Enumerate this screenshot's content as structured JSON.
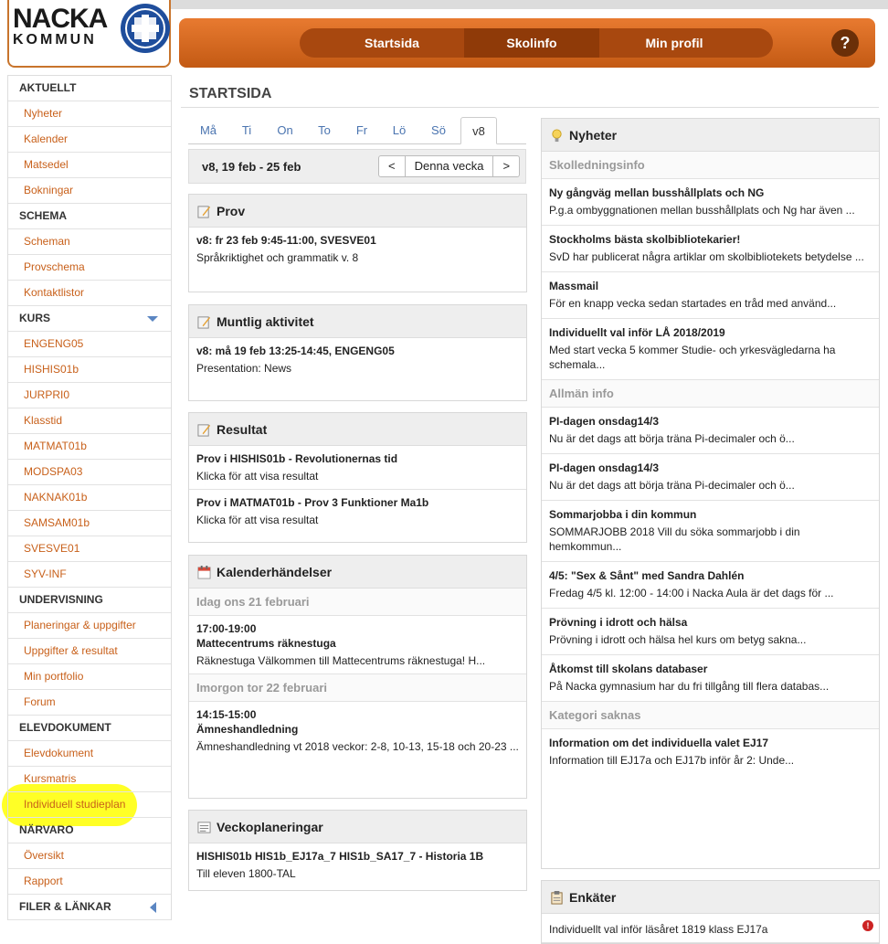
{
  "logo": {
    "line1": "NACKA",
    "line2": "KOMMUN"
  },
  "nav": {
    "startsida": "Startsida",
    "skolinfo": "Skolinfo",
    "minprofil": "Min profil",
    "help": "?"
  },
  "sidebar": [
    {
      "label": "AKTUELLT",
      "head": true
    },
    {
      "label": "Nyheter"
    },
    {
      "label": "Kalender"
    },
    {
      "label": "Matsedel"
    },
    {
      "label": "Bokningar"
    },
    {
      "label": "SCHEMA",
      "head": true
    },
    {
      "label": "Scheman"
    },
    {
      "label": "Provschema"
    },
    {
      "label": "Kontaktlistor"
    },
    {
      "label": "KURS",
      "head": true,
      "arrow": "down"
    },
    {
      "label": "ENGENG05"
    },
    {
      "label": "HISHIS01b"
    },
    {
      "label": "JURPRI0"
    },
    {
      "label": "Klasstid"
    },
    {
      "label": "MATMAT01b"
    },
    {
      "label": "MODSPA03"
    },
    {
      "label": "NAKNAK01b"
    },
    {
      "label": "SAMSAM01b"
    },
    {
      "label": "SVESVE01"
    },
    {
      "label": "SYV-INF"
    },
    {
      "label": "UNDERVISNING",
      "head": true
    },
    {
      "label": "Planeringar & uppgifter"
    },
    {
      "label": "Uppgifter & resultat"
    },
    {
      "label": "Min portfolio"
    },
    {
      "label": "Forum"
    },
    {
      "label": "ELEVDOKUMENT",
      "head": true
    },
    {
      "label": "Elevdokument"
    },
    {
      "label": "Kursmatris"
    },
    {
      "label": "Individuell studieplan"
    },
    {
      "label": "NÄRVARO",
      "head": true
    },
    {
      "label": "Översikt"
    },
    {
      "label": "Rapport"
    },
    {
      "label": "FILER & LÄNKAR",
      "head": true,
      "arrow": "left"
    }
  ],
  "page": {
    "title": "STARTSIDA"
  },
  "days": [
    "Må",
    "Ti",
    "On",
    "To",
    "Fr",
    "Lö",
    "Sö",
    "v8"
  ],
  "week": {
    "label": "v8, 19 feb - 25 feb",
    "prev": "<",
    "current": "Denna vecka",
    "next": ">"
  },
  "prov": {
    "title": "Prov",
    "items": [
      {
        "title": "v8: fr 23 feb 9:45-11:00, SVESVE01",
        "desc": "Språkriktighet och grammatik v. 8"
      }
    ]
  },
  "muntlig": {
    "title": "Muntlig aktivitet",
    "items": [
      {
        "title": "v8: må 19 feb 13:25-14:45, ENGENG05",
        "desc": "Presentation: News"
      }
    ]
  },
  "resultat": {
    "title": "Resultat",
    "items": [
      {
        "title": "Prov i HISHIS01b - Revolutionernas tid",
        "desc": "Klicka för att visa resultat"
      },
      {
        "title": "Prov i MATMAT01b - Prov 3 Funktioner Ma1b",
        "desc": "Klicka för att visa resultat"
      }
    ]
  },
  "kalender": {
    "title": "Kalenderhändelser",
    "groups": [
      {
        "label": "Idag ons 21 februari",
        "items": [
          {
            "time": "17:00-19:00",
            "title": "Mattecentrums räknestuga",
            "desc": "Räknestuga Välkommen till Mattecentrums räknestuga! H..."
          }
        ]
      },
      {
        "label": "Imorgon tor 22 februari",
        "items": [
          {
            "time": "14:15-15:00",
            "title": "Ämneshandledning",
            "desc": "Ämneshandledning vt 2018 veckor: 2-8, 10-13, 15-18 och 20-23 ..."
          }
        ]
      }
    ]
  },
  "vecko": {
    "title": "Veckoplaneringar",
    "items": [
      {
        "title": "HISHIS01b HIS1b_EJ17a_7 HIS1b_SA17_7 - Historia 1B",
        "desc": "Till eleven 1800-TAL"
      }
    ]
  },
  "nyheter": {
    "title": "Nyheter",
    "groups": [
      {
        "label": "Skolledningsinfo",
        "items": [
          {
            "title": "Ny gångväg mellan busshållplats och NG",
            "desc": "P.g.a ombyggnationen mellan busshållplats och Ng har även ..."
          },
          {
            "title": "Stockholms bästa skolbibliotekarier!",
            "desc": "SvD har publicerat några artiklar om skolbibliotekets betydelse ..."
          },
          {
            "title": "Massmail",
            "desc": "För en knapp vecka sedan startades en tråd med använd..."
          },
          {
            "title": "Individuellt val inför LÅ 2018/2019",
            "desc": "Med start vecka 5 kommer Studie- och yrkesvägledarna ha schemala..."
          }
        ]
      },
      {
        "label": "Allmän info",
        "items": [
          {
            "title": "PI-dagen onsdag14/3",
            "desc": "Nu är det dags att börja träna Pi-decimaler och ö..."
          },
          {
            "title": "PI-dagen onsdag14/3",
            "desc": "Nu är det dags att börja träna Pi-decimaler och ö..."
          },
          {
            "title": "Sommarjobba i din kommun",
            "desc": "SOMMARJOBB 2018   Vill du söka sommarjobb i din hemkommun..."
          },
          {
            "title": "4/5: \"Sex & Sånt\" med Sandra Dahlén",
            "desc": "Fredag 4/5 kl. 12:00 - 14:00 i Nacka Aula är det dags för ..."
          },
          {
            "title": "Prövning i idrott och hälsa",
            "desc": "  Prövning i idrott och hälsa hel kurs om betyg sakna..."
          },
          {
            "title": "Åtkomst till skolans databaser",
            "desc": "På Nacka gymnasium har du fri tillgång till flera databas..."
          }
        ]
      },
      {
        "label": "Kategori saknas",
        "items": [
          {
            "title": "Information om det individuella valet EJ17",
            "desc": "Information till EJ17a och EJ17b inför år 2:   Unde..."
          }
        ]
      }
    ]
  },
  "enkater": {
    "title": "Enkäter",
    "items": [
      {
        "desc": "Individuellt val inför läsåret 1819 klass EJ17a"
      }
    ]
  },
  "colors": {
    "orange": "#c8601a",
    "nav": "#d8661e",
    "link": "#4a74b0"
  }
}
